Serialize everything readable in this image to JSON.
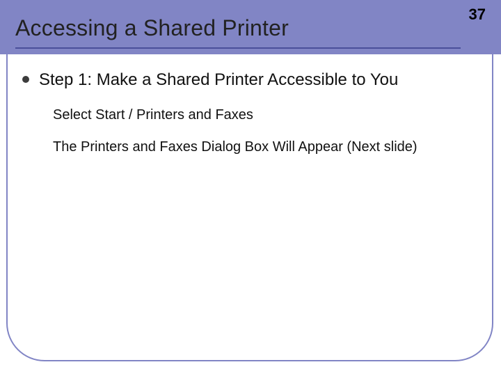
{
  "slide": {
    "page_number": "37",
    "title": "Accessing a Shared Printer",
    "bullet_main": "Step 1: Make a Shared Printer Accessible to You",
    "sub1": "Select Start / Printers and Faxes",
    "sub2": "The Printers and Faxes Dialog Box Will Appear (Next slide)"
  }
}
